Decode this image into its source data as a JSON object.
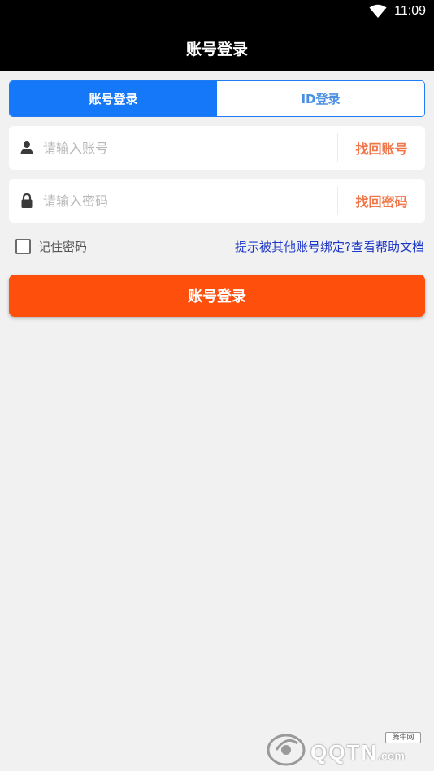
{
  "status_bar": {
    "time": "11:09",
    "wifi_icon": "wifi-icon"
  },
  "header": {
    "title": "账号登录"
  },
  "tabs": [
    {
      "label": "账号登录",
      "active": true
    },
    {
      "label": "ID登录",
      "active": false
    }
  ],
  "account_field": {
    "icon": "person-icon",
    "placeholder": "请输入账号",
    "value": "",
    "recover_label": "找回账号"
  },
  "password_field": {
    "icon": "lock-icon",
    "placeholder": "请输入密码",
    "value": "",
    "recover_label": "找回密码"
  },
  "remember": {
    "label": "记住密码",
    "checked": false
  },
  "help_link": "提示被其他账号绑定?查看帮助文档",
  "login_button": "账号登录",
  "watermark": {
    "text": "QQTN",
    "sub": "腾牛网",
    "domain": ".com"
  },
  "colors": {
    "primary_blue": "#1478f8",
    "accent_orange": "#fe4f0c",
    "link_blue": "#1a35c8",
    "recover_orange": "#f0774a"
  }
}
